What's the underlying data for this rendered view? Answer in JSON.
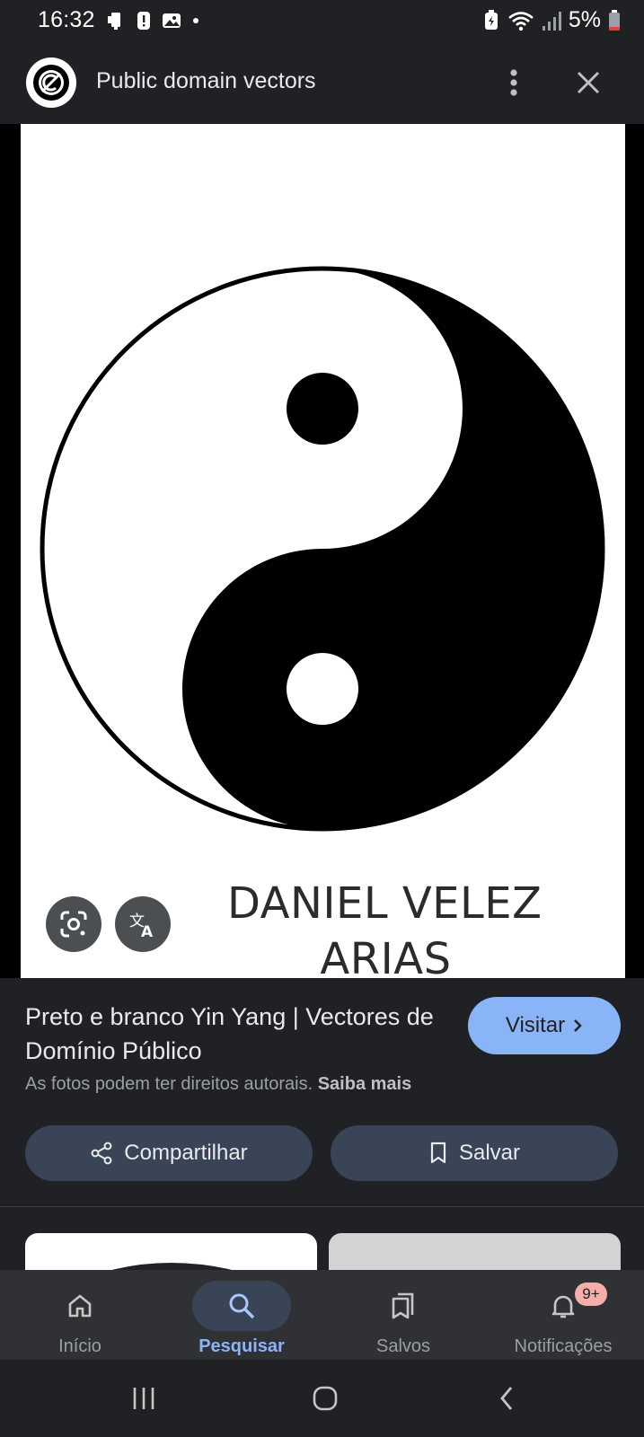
{
  "status_bar": {
    "time": "16:32",
    "battery": "5%",
    "left_icons": [
      "phone-icon",
      "alert-icon",
      "gallery-icon"
    ],
    "right_icons": [
      "battery-saver-icon",
      "wifi-icon",
      "signal-icon",
      "battery-icon"
    ]
  },
  "header": {
    "site_name": "Public domain vectors",
    "logo_icon": "public-domain-logo-icon",
    "more_icon": "more-vert-icon",
    "close_icon": "close-icon"
  },
  "image": {
    "caption_line1": "DANIEL VELEZ",
    "caption_line2": "ARIAS",
    "lens_icon": "google-lens-icon",
    "translate_icon": "translate-icon"
  },
  "result": {
    "title": "Preto e branco Yin Yang | Vectores de Domínio Público",
    "visit_label": "Visitar",
    "copyright_text": "As fotos podem ter direitos autorais.",
    "learn_more": "Saiba mais",
    "share_label": "Compartilhar",
    "save_label": "Salvar"
  },
  "bottom_nav": {
    "items": [
      {
        "label": "Início",
        "icon": "home-icon",
        "active": false
      },
      {
        "label": "Pesquisar",
        "icon": "search-icon",
        "active": true
      },
      {
        "label": "Salvos",
        "icon": "collections-icon",
        "active": false
      },
      {
        "label": "Notificações",
        "icon": "bell-icon",
        "active": false
      }
    ],
    "notification_badge": "9+"
  },
  "colors": {
    "background": "#202124",
    "accent": "#8ab4f8",
    "button_bg": "#394457",
    "badge": "#f6aea9"
  }
}
